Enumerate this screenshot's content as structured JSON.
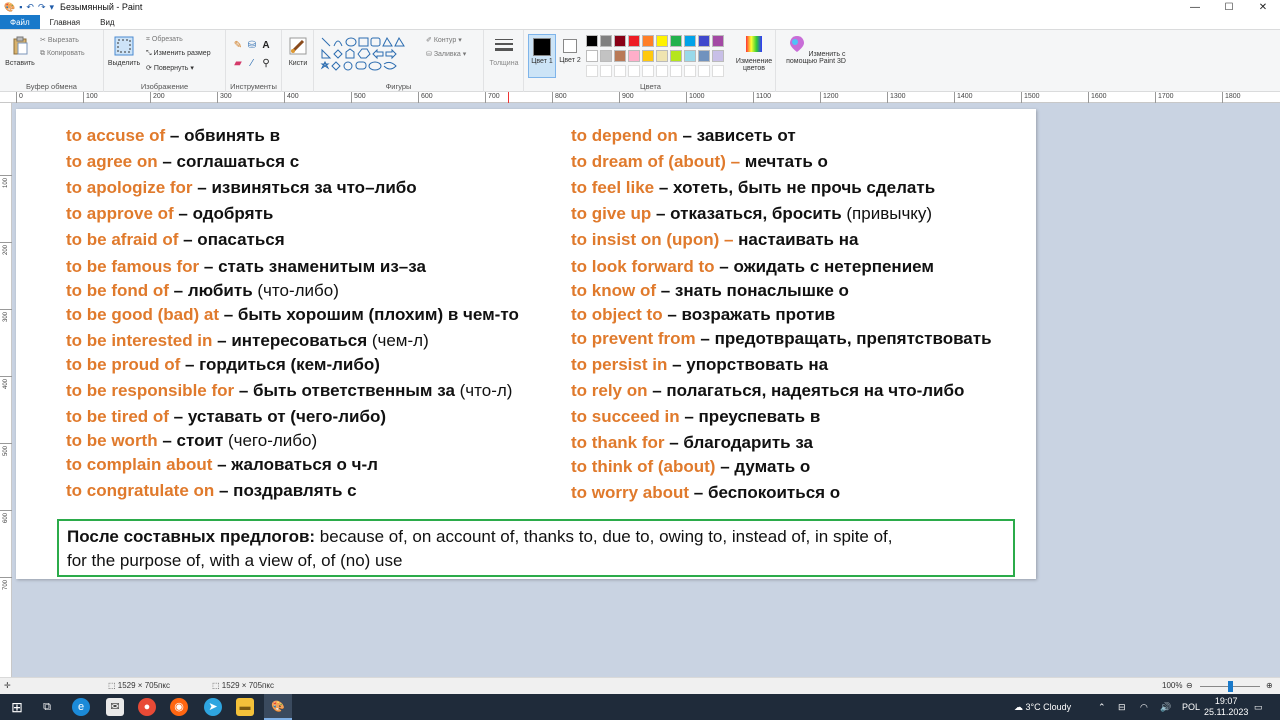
{
  "window": {
    "title": "Безымянный - Paint",
    "controls": {
      "minimize": "—",
      "maximize": "☐",
      "close": "✕"
    }
  },
  "tabs": [
    "Файл",
    "Главная",
    "Вид"
  ],
  "ribbon": {
    "clipboard": {
      "label": "Буфер обмена",
      "paste": "Вставить",
      "cut": "Вырезать",
      "copy": "Копировать"
    },
    "image": {
      "label": "Изображение",
      "select": "Выделить",
      "crop": "Обрезать",
      "resize": "Изменить размер",
      "rotate": "Повернуть"
    },
    "tools": {
      "label": "Инструменты"
    },
    "brushes": {
      "label": "Кисти"
    },
    "shapes": {
      "label": "Фигуры",
      "outline": "Контур",
      "fill": "Заливка"
    },
    "size": {
      "label": "Толщина"
    },
    "colors": {
      "label": "Цвета",
      "color1": "Цвет 1",
      "color2": "Цвет 2",
      "edit": "Изменение цветов",
      "palette_row1": [
        "#000000",
        "#7f7f7f",
        "#880015",
        "#ed1c24",
        "#ff7f27",
        "#fff200",
        "#22b14c",
        "#00a2e8",
        "#3f48cc",
        "#a349a4"
      ],
      "palette_row2": [
        "#ffffff",
        "#c3c3c3",
        "#b97a57",
        "#ffaec9",
        "#ffc90e",
        "#efe4b0",
        "#b5e61d",
        "#99d9ea",
        "#7092be",
        "#c8bfe7"
      ]
    },
    "paint3d": {
      "label": "Изменить с помощью Paint 3D"
    }
  },
  "ruler": {
    "h": [
      "0",
      "100",
      "200",
      "300",
      "400",
      "500",
      "600",
      "700",
      "800",
      "900",
      "1000",
      "1100",
      "1200",
      "1300",
      "1400",
      "1500",
      "1600",
      "1700",
      "1800"
    ],
    "v": [
      "100",
      "200",
      "300",
      "400",
      "500",
      "600",
      "700"
    ]
  },
  "content": {
    "left": [
      {
        "en": "to accuse of",
        "ru": " – обвинять в",
        "rest": ""
      },
      {
        "en": "to agree on",
        "ru": " – соглашаться с",
        "rest": ""
      },
      {
        "en": "to apologize for",
        "ru": " – извиняться за что–либо",
        "rest": ""
      },
      {
        "en": "to approve of",
        "ru": " – одобрять",
        "rest": ""
      },
      {
        "en": "to be afraid of",
        "ru": " – опасаться",
        "rest": ""
      },
      {
        "en": "to be famous for",
        "ru": " – стать знаменитым из–за",
        "rest": ""
      },
      {
        "en": "to be fond of",
        "ru": " – любить",
        "rest": " (что-либо)"
      },
      {
        "en": "to be good (bad) at",
        "ru": " – быть хорошим (плохим) в чем-то",
        "rest": ""
      },
      {
        "en": "to be interested in",
        "ru": " – интересоваться",
        "rest": " (чем-л)"
      },
      {
        "en": "to be proud of",
        "ru": " – гордиться (кем-либо)",
        "rest": ""
      },
      {
        "en": "to be responsible for ",
        "ru": " – быть ответственным за",
        "rest": " (что-л)"
      },
      {
        "en": "to be tired of",
        "ru": " – уставать от (чего-либо)",
        "rest": ""
      },
      {
        "en": "to be worth",
        "ru": " – стоит",
        "rest": " (чего-либо)"
      },
      {
        "en": "to complain about",
        "ru": " – жаловаться о ч-л",
        "rest": ""
      },
      {
        "en": "to congratulate on",
        "ru": " – поздравлять с",
        "rest": ""
      }
    ],
    "right": [
      {
        "en": "to depend on",
        "ru": " – зависеть от",
        "rest": ""
      },
      {
        "en": "to dream of (about) –",
        "ru": " мечтать о",
        "rest": ""
      },
      {
        "en": "to feel like",
        "ru": " – хотеть, быть не прочь сделать",
        "rest": ""
      },
      {
        "en": "to give up",
        "ru": " – отказаться, бросить",
        "rest": " (привычку)"
      },
      {
        "en": "to insist on (upon) –",
        "ru": " настаивать на",
        "rest": ""
      },
      {
        "en": "to look forward to",
        "ru": " – ожидать с нетерпением",
        "rest": ""
      },
      {
        "en": "to know of",
        "ru": " – знать понаслышке о",
        "rest": ""
      },
      {
        "en": "to object to",
        "ru": " – возражать против",
        "rest": ""
      },
      {
        "en": "to prevent from",
        "ru": " – предотвращать, препятствовать",
        "rest": ""
      },
      {
        "en": "to persist in",
        "ru": " – упорствовать на",
        "rest": ""
      },
      {
        "en": "to rely on",
        "ru": " – полагаться, надеяться на что-либо",
        "rest": ""
      },
      {
        "en": "to succeed in",
        "ru": " – преуспевать в",
        "rest": ""
      },
      {
        "en": "to thank for",
        "ru": " – благодарить за",
        "rest": ""
      },
      {
        "en": "to think of (about)",
        "ru": " – думать о",
        "rest": ""
      },
      {
        "en": "to worry about",
        "ru": " – беспокоиться о",
        "rest": ""
      }
    ],
    "box": {
      "bold": "После составных предлогов:",
      "line1": " because of, on account of, thanks to, due to, owing to, instead of, in spite of,",
      "line2": "for the purpose of, with a view of, of (no) use"
    }
  },
  "status": {
    "selection": "1529 × 705пкс",
    "size": "1529 × 705пкс",
    "zoom": "100%",
    "zoom_level": 0.5
  },
  "taskbar": {
    "weather": "3°C  Cloudy",
    "lang": "POL",
    "time": "19:07",
    "date": "25.11.2023"
  }
}
